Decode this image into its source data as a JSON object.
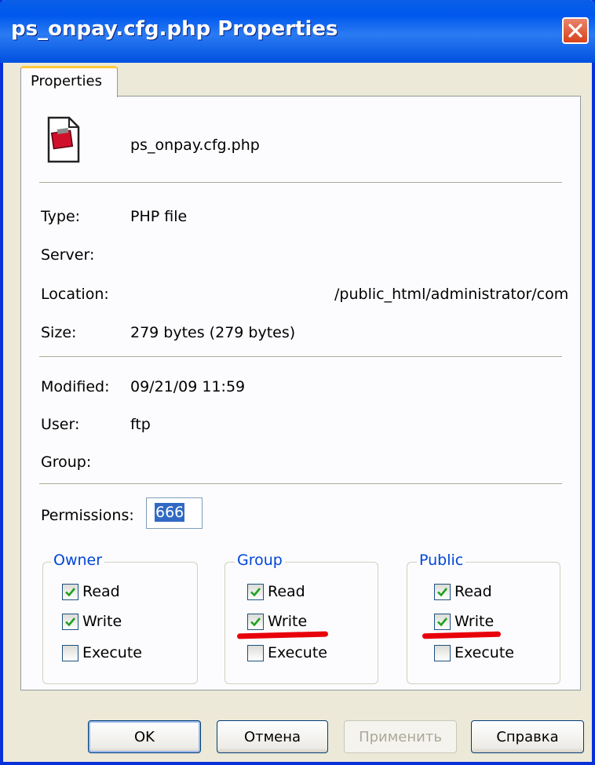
{
  "window": {
    "title": "ps_onpay.cfg.php Properties"
  },
  "tab": {
    "label": "Properties"
  },
  "file": {
    "name": "ps_onpay.cfg.php",
    "icon": "php-file-icon"
  },
  "info": {
    "type_label": "Type:",
    "type_value": "PHP file",
    "server_label": "Server:",
    "server_value": "",
    "location_label": "Location:",
    "location_value": "/public_html/administrator/com",
    "size_label": "Size:",
    "size_value": "279 bytes (279 bytes)",
    "modified_label": "Modified:",
    "modified_value": "09/21/09 11:59",
    "user_label": "User:",
    "user_value": "ftp",
    "group_label": "Group:",
    "group_value": ""
  },
  "permissions": {
    "label": "Permissions:",
    "value": "666",
    "groups": [
      {
        "title": "Owner",
        "read": "Read",
        "write": "Write",
        "execute": "Execute",
        "read_checked": true,
        "write_checked": true,
        "execute_checked": false
      },
      {
        "title": "Group",
        "read": "Read",
        "write": "Write",
        "execute": "Execute",
        "read_checked": true,
        "write_checked": true,
        "execute_checked": false
      },
      {
        "title": "Public",
        "read": "Read",
        "write": "Write",
        "execute": "Execute",
        "read_checked": true,
        "write_checked": true,
        "execute_checked": false
      }
    ]
  },
  "buttons": {
    "ok": "OK",
    "cancel": "Отмена",
    "apply": "Применить",
    "help": "Справка"
  },
  "colors": {
    "accent": "#0831D9",
    "selection": "#316AC5",
    "annotation": "#E8000A",
    "group_title": "#0046D5"
  }
}
